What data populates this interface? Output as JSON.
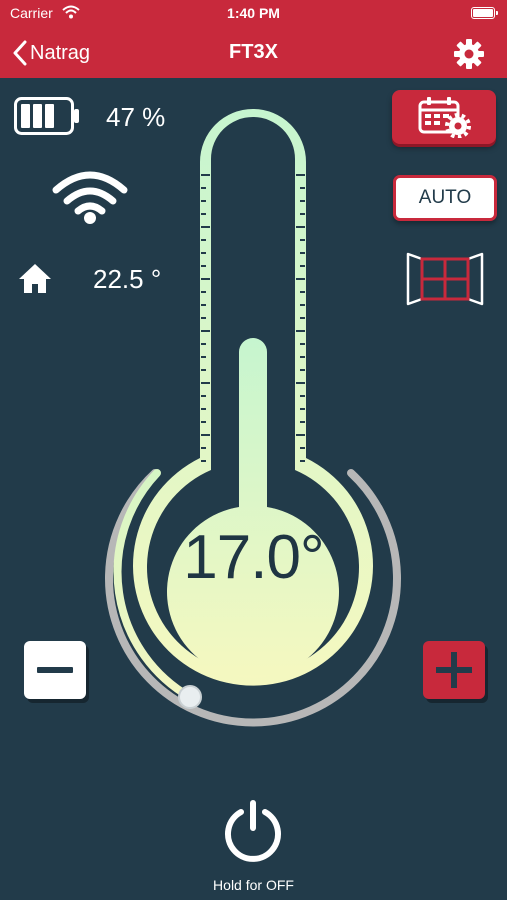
{
  "status_bar": {
    "carrier": "Carrier",
    "time": "1:40 PM"
  },
  "nav": {
    "back_label": "Natrag",
    "title": "FT3X"
  },
  "device": {
    "battery_percent": "47 %",
    "battery_level": 0.47,
    "room_temperature": "22.5 °"
  },
  "controls": {
    "mode_label": "AUTO",
    "setpoint": "17.0°",
    "power_hint": "Hold for OFF"
  },
  "colors": {
    "accent_red": "#c8293c",
    "background": "#223b4a",
    "thermo_green": "#c6f5cf",
    "thermo_yellow": "#f5f8c0"
  },
  "icons": [
    "chevron-left-icon",
    "gear-icon",
    "battery-icon",
    "wifi-icon",
    "home-icon",
    "calendar-gear-icon",
    "window-icon",
    "power-icon"
  ]
}
